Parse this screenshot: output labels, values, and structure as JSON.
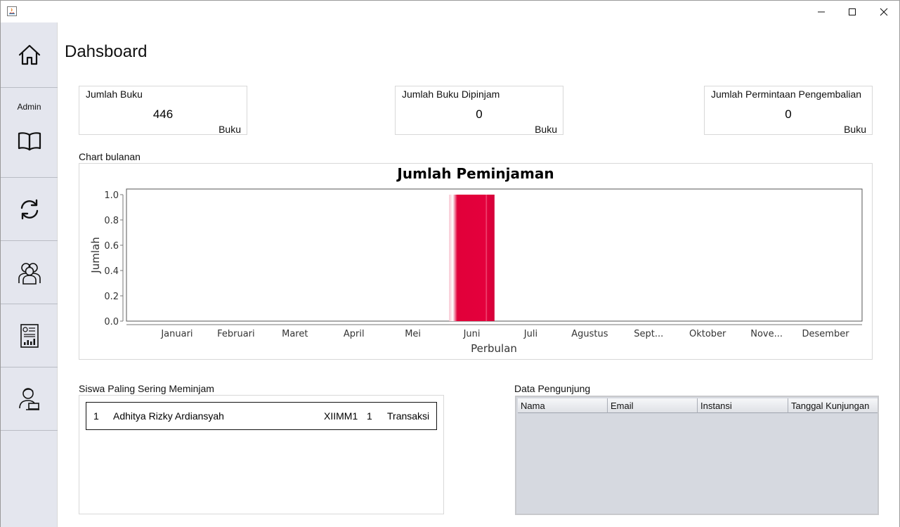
{
  "window": {
    "minimize_glyph": "minimize-icon",
    "maximize_glyph": "maximize-icon",
    "close_glyph": "close-icon"
  },
  "sidebar": {
    "items": [
      {
        "icon": "home-icon"
      },
      {
        "label": "Admin"
      },
      {
        "icon": "book-icon"
      },
      {
        "icon": "refresh-icon"
      },
      {
        "icon": "users-icon"
      },
      {
        "icon": "report-icon"
      },
      {
        "icon": "user-laptop-icon"
      }
    ]
  },
  "page": {
    "title": "Dahsboard"
  },
  "cards": [
    {
      "title": "Jumlah Buku",
      "value": "446",
      "unit": "Buku"
    },
    {
      "title": "Jumlah Buku Dipinjam",
      "value": "0",
      "unit": "Buku"
    },
    {
      "title": "Jumlah Permintaan Pengembalian",
      "value": "0",
      "unit": "Buku"
    }
  ],
  "chart_section": {
    "label": "Chart bulanan"
  },
  "chart_data": {
    "type": "bar",
    "title": "Jumlah Peminjaman",
    "xlabel": "Perbulan",
    "ylabel": "Jumlah",
    "categories": [
      "Januari",
      "Februari",
      "Maret",
      "April",
      "Mei",
      "Juni",
      "Juli",
      "Agustus",
      "Sept...",
      "Oktober",
      "Nove...",
      "Desember"
    ],
    "values": [
      0,
      0,
      0,
      0,
      0,
      1,
      0,
      0,
      0,
      0,
      0,
      0
    ],
    "ylim": [
      0,
      1
    ],
    "yticks": [
      "0.0",
      "0.2",
      "0.4",
      "0.6",
      "0.8",
      "1.0"
    ],
    "bar_color": "#e1003a",
    "grid": false
  },
  "top_borrowers": {
    "label": "Siswa Paling Sering Meminjam",
    "rows": [
      {
        "rank": "1",
        "name": "Adhitya Rizky Ardiansyah",
        "class": "XIIMM1",
        "count": "1",
        "unit": "Transaksi"
      }
    ]
  },
  "visitors": {
    "label": "Data Pengunjung",
    "columns": [
      "Nama",
      "Email",
      "Instansi",
      "Tanggal Kunjungan"
    ],
    "rows": []
  }
}
